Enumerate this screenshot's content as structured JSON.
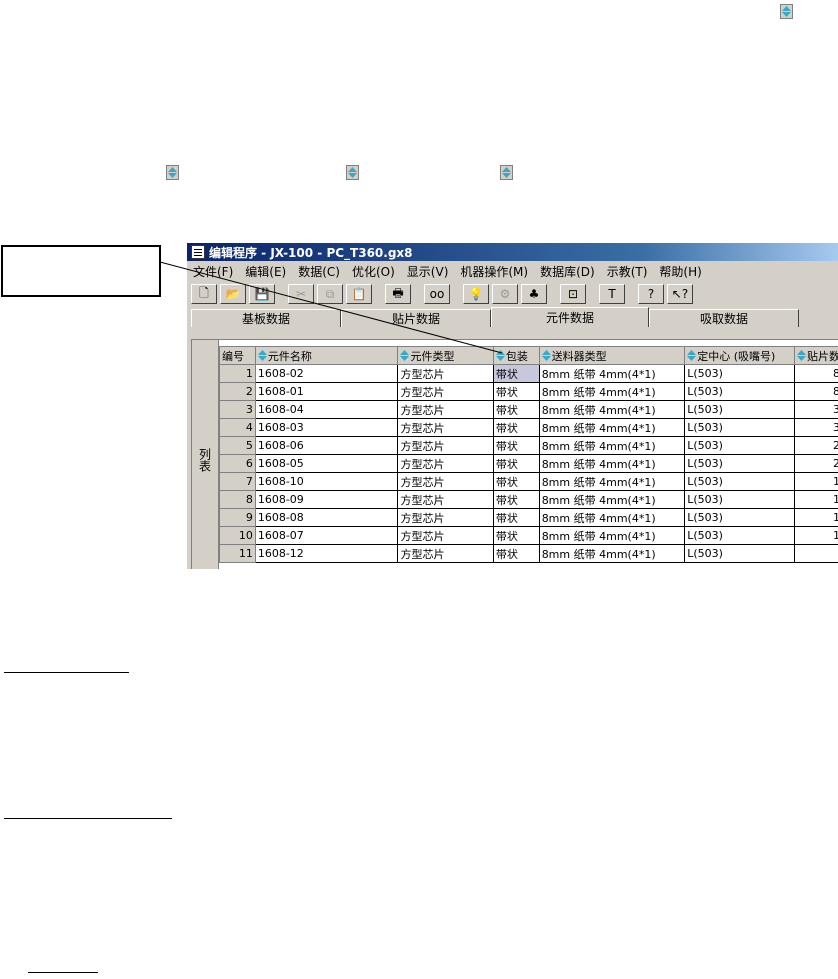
{
  "window": {
    "title": "编辑程序 - JX-100 - PC_T360.gx8"
  },
  "menu": [
    "文件(F)",
    "编辑(E)",
    "数据(C)",
    "优化(O)",
    "显示(V)",
    "机器操作(M)",
    "数据库(D)",
    "示教(T)",
    "帮助(H)"
  ],
  "toolbar": {
    "buttons": [
      {
        "name": "new-file-icon",
        "glyph": "🗋"
      },
      {
        "name": "open-folder-icon",
        "glyph": "📂"
      },
      {
        "name": "save-icon",
        "glyph": "💾"
      },
      {
        "name": "cut-icon",
        "glyph": "✂"
      },
      {
        "name": "copy-icon",
        "glyph": "⧉"
      },
      {
        "name": "paste-icon",
        "glyph": "📋"
      },
      {
        "name": "print-icon",
        "glyph": "🖶"
      },
      {
        "name": "find-icon",
        "glyph": "oo"
      },
      {
        "name": "lightbulb-icon",
        "glyph": "💡"
      },
      {
        "name": "nozzle-icon",
        "glyph": "⚙"
      },
      {
        "name": "components-icon",
        "glyph": "♣"
      },
      {
        "name": "center-icon",
        "glyph": "⊡"
      },
      {
        "name": "text-icon",
        "glyph": "T"
      },
      {
        "name": "help-icon",
        "glyph": "?"
      },
      {
        "name": "context-help-icon",
        "glyph": "↖?"
      }
    ]
  },
  "tabs": [
    "基板数据",
    "贴片数据",
    "元件数据",
    "吸取数据"
  ],
  "active_tab": 2,
  "side_label": "列表",
  "table": {
    "columns": [
      "编号",
      "元件名称",
      "元件类型",
      "包装",
      "送料器类型",
      "定中心 (吸嘴号)",
      "贴片数"
    ],
    "sortable": [
      false,
      true,
      true,
      true,
      true,
      true,
      true
    ],
    "rows": [
      [
        "1",
        "1608-02",
        "方型芯片",
        "带状",
        "8mm 纸带  4mm(4*1)",
        "L(503)",
        "8"
      ],
      [
        "2",
        "1608-01",
        "方型芯片",
        "带状",
        "8mm 纸带  4mm(4*1)",
        "L(503)",
        "8"
      ],
      [
        "3",
        "1608-04",
        "方型芯片",
        "带状",
        "8mm 纸带  4mm(4*1)",
        "L(503)",
        "3"
      ],
      [
        "4",
        "1608-03",
        "方型芯片",
        "带状",
        "8mm 纸带  4mm(4*1)",
        "L(503)",
        "3"
      ],
      [
        "5",
        "1608-06",
        "方型芯片",
        "带状",
        "8mm 纸带  4mm(4*1)",
        "L(503)",
        "2"
      ],
      [
        "6",
        "1608-05",
        "方型芯片",
        "带状",
        "8mm 纸带  4mm(4*1)",
        "L(503)",
        "2"
      ],
      [
        "7",
        "1608-10",
        "方型芯片",
        "带状",
        "8mm 纸带  4mm(4*1)",
        "L(503)",
        "1"
      ],
      [
        "8",
        "1608-09",
        "方型芯片",
        "带状",
        "8mm 纸带  4mm(4*1)",
        "L(503)",
        "1"
      ],
      [
        "9",
        "1608-08",
        "方型芯片",
        "带状",
        "8mm 纸带  4mm(4*1)",
        "L(503)",
        "1"
      ],
      [
        "10",
        "1608-07",
        "方型芯片",
        "带状",
        "8mm 纸带  4mm(4*1)",
        "L(503)",
        "1"
      ],
      [
        "11",
        "1608-12",
        "方型芯片",
        "带状",
        "8mm 纸带  4mm(4*1)",
        "L(503)",
        ""
      ]
    ]
  },
  "colors": {
    "sort_up": "#3aa6c8",
    "sort_down": "#3aa6c8",
    "title_bar": "#0a246a",
    "selected_cell": "#c8c8dc"
  }
}
